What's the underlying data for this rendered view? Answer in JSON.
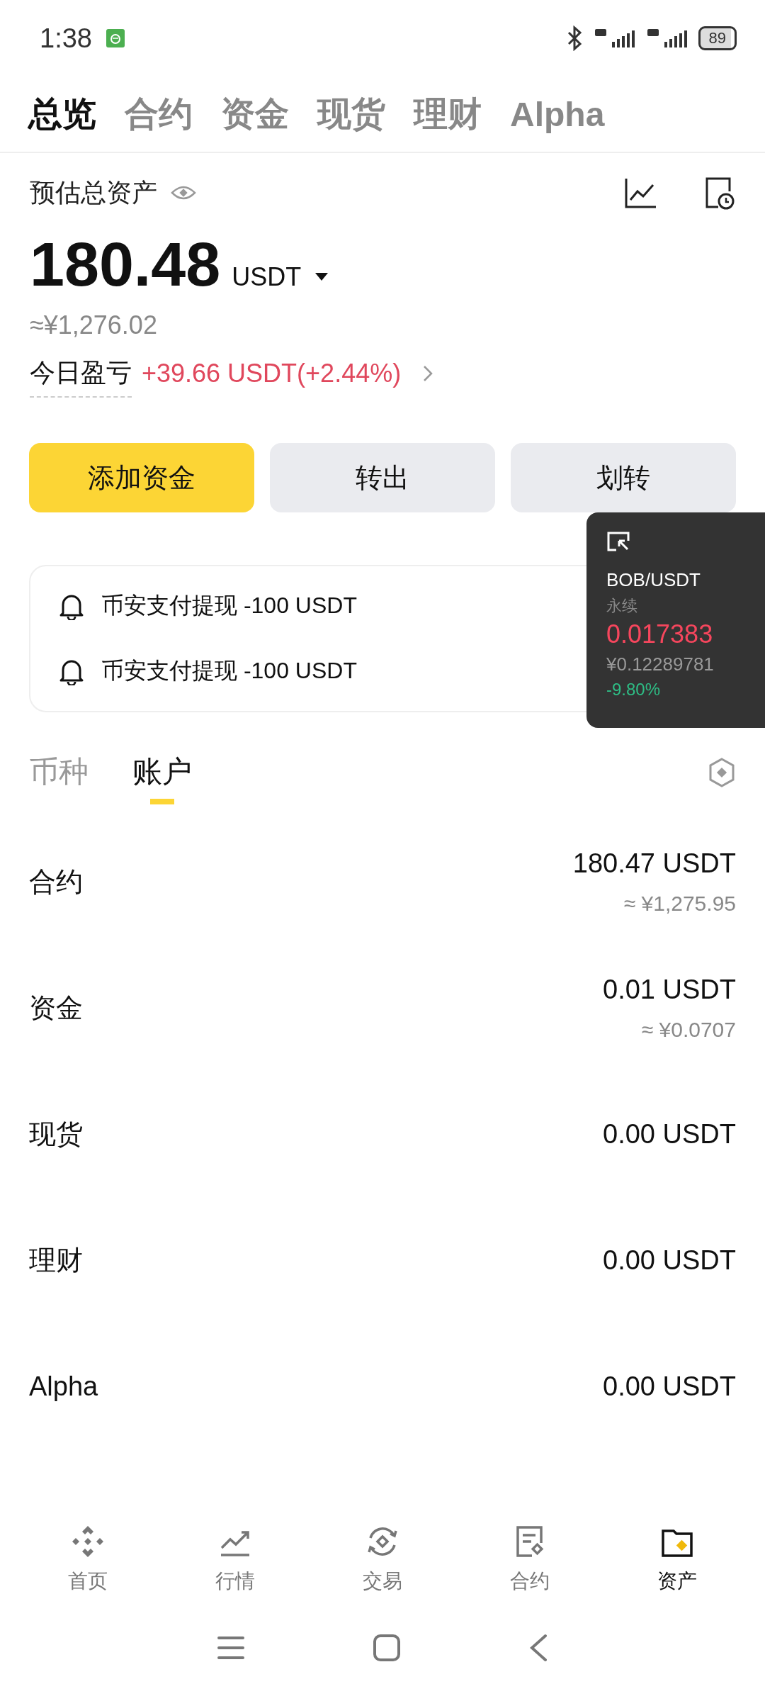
{
  "status_bar": {
    "time": "1:38",
    "battery": "89"
  },
  "top_tabs": [
    {
      "label": "总览",
      "selected": true
    },
    {
      "label": "合约",
      "selected": false
    },
    {
      "label": "资金",
      "selected": false
    },
    {
      "label": "现货",
      "selected": false
    },
    {
      "label": "理财",
      "selected": false
    },
    {
      "label": "Alpha",
      "selected": false
    }
  ],
  "summary": {
    "label": "预估总资产",
    "amount": "180.48",
    "currency": "USDT",
    "fiat": "≈¥1,276.02",
    "pnl_label": "今日盈亏",
    "pnl_value": "+39.66 USDT(+2.44%)"
  },
  "actions": [
    {
      "label": "添加资金",
      "kind": "primary"
    },
    {
      "label": "转出",
      "kind": "secondary"
    },
    {
      "label": "划转",
      "kind": "secondary"
    }
  ],
  "notifications": [
    {
      "text": "币安支付提现 -100 USDT"
    },
    {
      "text": "币安支付提现 -100 USDT"
    }
  ],
  "floating_ticker": {
    "pair": "BOB/USDT",
    "type": "永续",
    "price": "0.017383",
    "fiat_price": "¥0.12289781",
    "change": "-9.80%"
  },
  "section_tabs": [
    {
      "label": "币种",
      "selected": false
    },
    {
      "label": "账户",
      "selected": true
    }
  ],
  "accounts": [
    {
      "name": "合约",
      "value": "180.47 USDT",
      "fiat": "≈ ¥1,275.95"
    },
    {
      "name": "资金",
      "value": "0.01 USDT",
      "fiat": "≈ ¥0.0707"
    },
    {
      "name": "现货",
      "value": "0.00 USDT"
    },
    {
      "name": "理财",
      "value": "0.00 USDT"
    },
    {
      "name": "Alpha",
      "value": "0.00 USDT"
    }
  ],
  "bottom_nav": [
    {
      "label": "首页",
      "selected": false
    },
    {
      "label": "行情",
      "selected": false
    },
    {
      "label": "交易",
      "selected": false
    },
    {
      "label": "合约",
      "selected": false
    },
    {
      "label": "资产",
      "selected": true
    }
  ]
}
